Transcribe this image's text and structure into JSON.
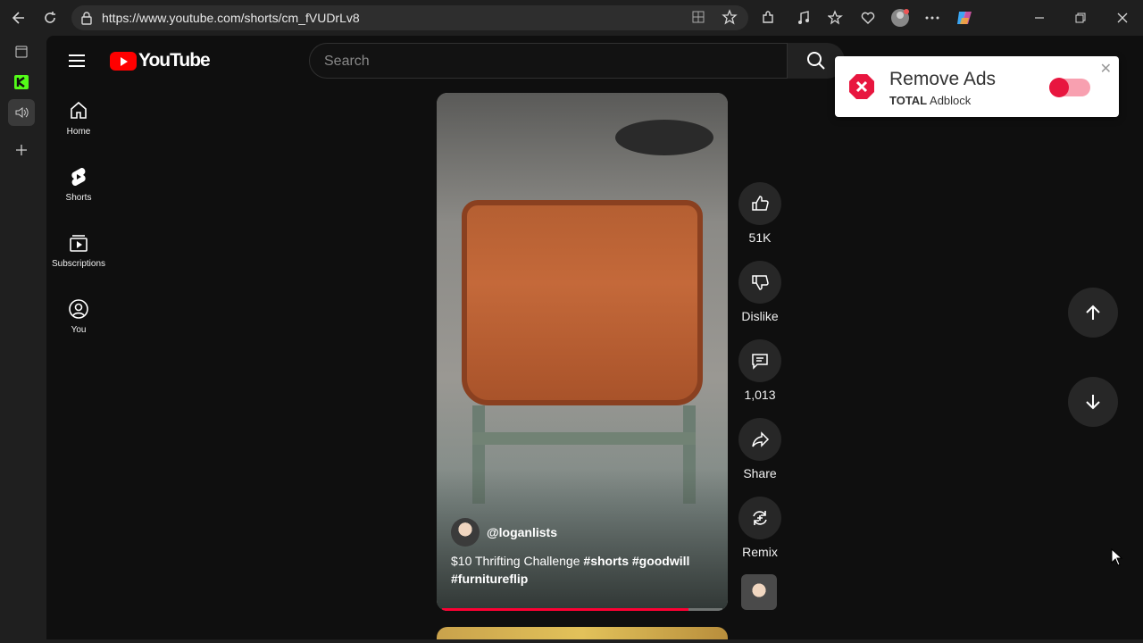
{
  "browser": {
    "url": "https://www.youtube.com/shorts/cm_fVUDrLv8"
  },
  "youtube": {
    "logo_text": "YouTube",
    "search_placeholder": "Search",
    "guide": [
      {
        "label": "Home",
        "icon": "home-icon"
      },
      {
        "label": "Shorts",
        "icon": "shorts-icon"
      },
      {
        "label": "Subscriptions",
        "icon": "subscriptions-icon"
      },
      {
        "label": "You",
        "icon": "you-icon"
      }
    ]
  },
  "short": {
    "channel": "@loganlists",
    "title_plain": "$10 Thrifting Challenge ",
    "title_tags": "#shorts #goodwill",
    "title_tags2": "#furnitureflip",
    "progress_percent": 88,
    "progress_color": "#ff0033"
  },
  "actions": {
    "like_count": "51K",
    "dislike_label": "Dislike",
    "comment_count": "1,013",
    "share_label": "Share",
    "remix_label": "Remix"
  },
  "adblock": {
    "title": "Remove Ads",
    "brand_bold": "TOTAL",
    "brand_rest": " Adblock",
    "toggle_on": true,
    "accent": "#e8163f"
  }
}
